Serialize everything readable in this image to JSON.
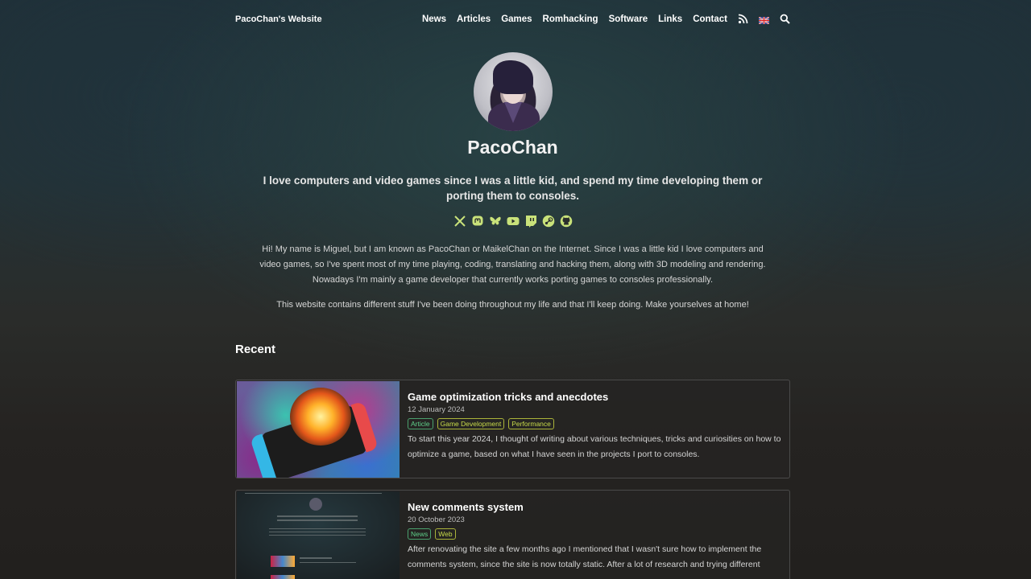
{
  "site": {
    "title": "PacoChan's Website"
  },
  "nav": {
    "items": [
      "News",
      "Articles",
      "Games",
      "Romhacking",
      "Software",
      "Links",
      "Contact"
    ],
    "icons": [
      "rss-icon",
      "uk-flag-icon",
      "search-icon"
    ]
  },
  "profile": {
    "name": "PacoChan",
    "tagline": "I love computers and video games since I was a little kid, and spend my time developing them or porting them to consoles.",
    "socials": [
      "x-icon",
      "mastodon-icon",
      "bluesky-icon",
      "youtube-icon",
      "twitch-icon",
      "steam-icon",
      "github-icon"
    ],
    "intro": "Hi! My name is Miguel, but I am known as PacoChan or MaikelChan on the Internet. Since I was a little kid I love computers and video games, so I've spent most of my time playing, coding, translating and hacking them, along with 3D modeling and rendering. Nowadays I'm mainly a game developer that currently works porting games to consoles professionally.",
    "intro2": "This website contains different stuff I've been doing throughout my life and that I'll keep doing. Make yourselves at home!"
  },
  "recent": {
    "title": "Recent",
    "posts": [
      {
        "title": "Game optimization tricks and anecdotes",
        "date": "12 January 2024",
        "tags": [
          "Article",
          "Game Development",
          "Performance"
        ],
        "description": "To start this year 2024, I thought of writing about various techniques, tricks and curiosities on how to optimize a game, based on what I have seen in the projects I port to consoles."
      },
      {
        "title": "New comments system",
        "date": "20 October 2023",
        "tags": [
          "News",
          "Web"
        ],
        "description": "After renovating the site a few months ago I mentioned that I wasn't sure how to implement the comments system, since the site is now totally static. After a lot of research and trying different"
      }
    ]
  },
  "colors": {
    "tag_green": "#5fd08a",
    "tag_lime": "#c9dc4a",
    "social_icon": "#c9e27a"
  }
}
